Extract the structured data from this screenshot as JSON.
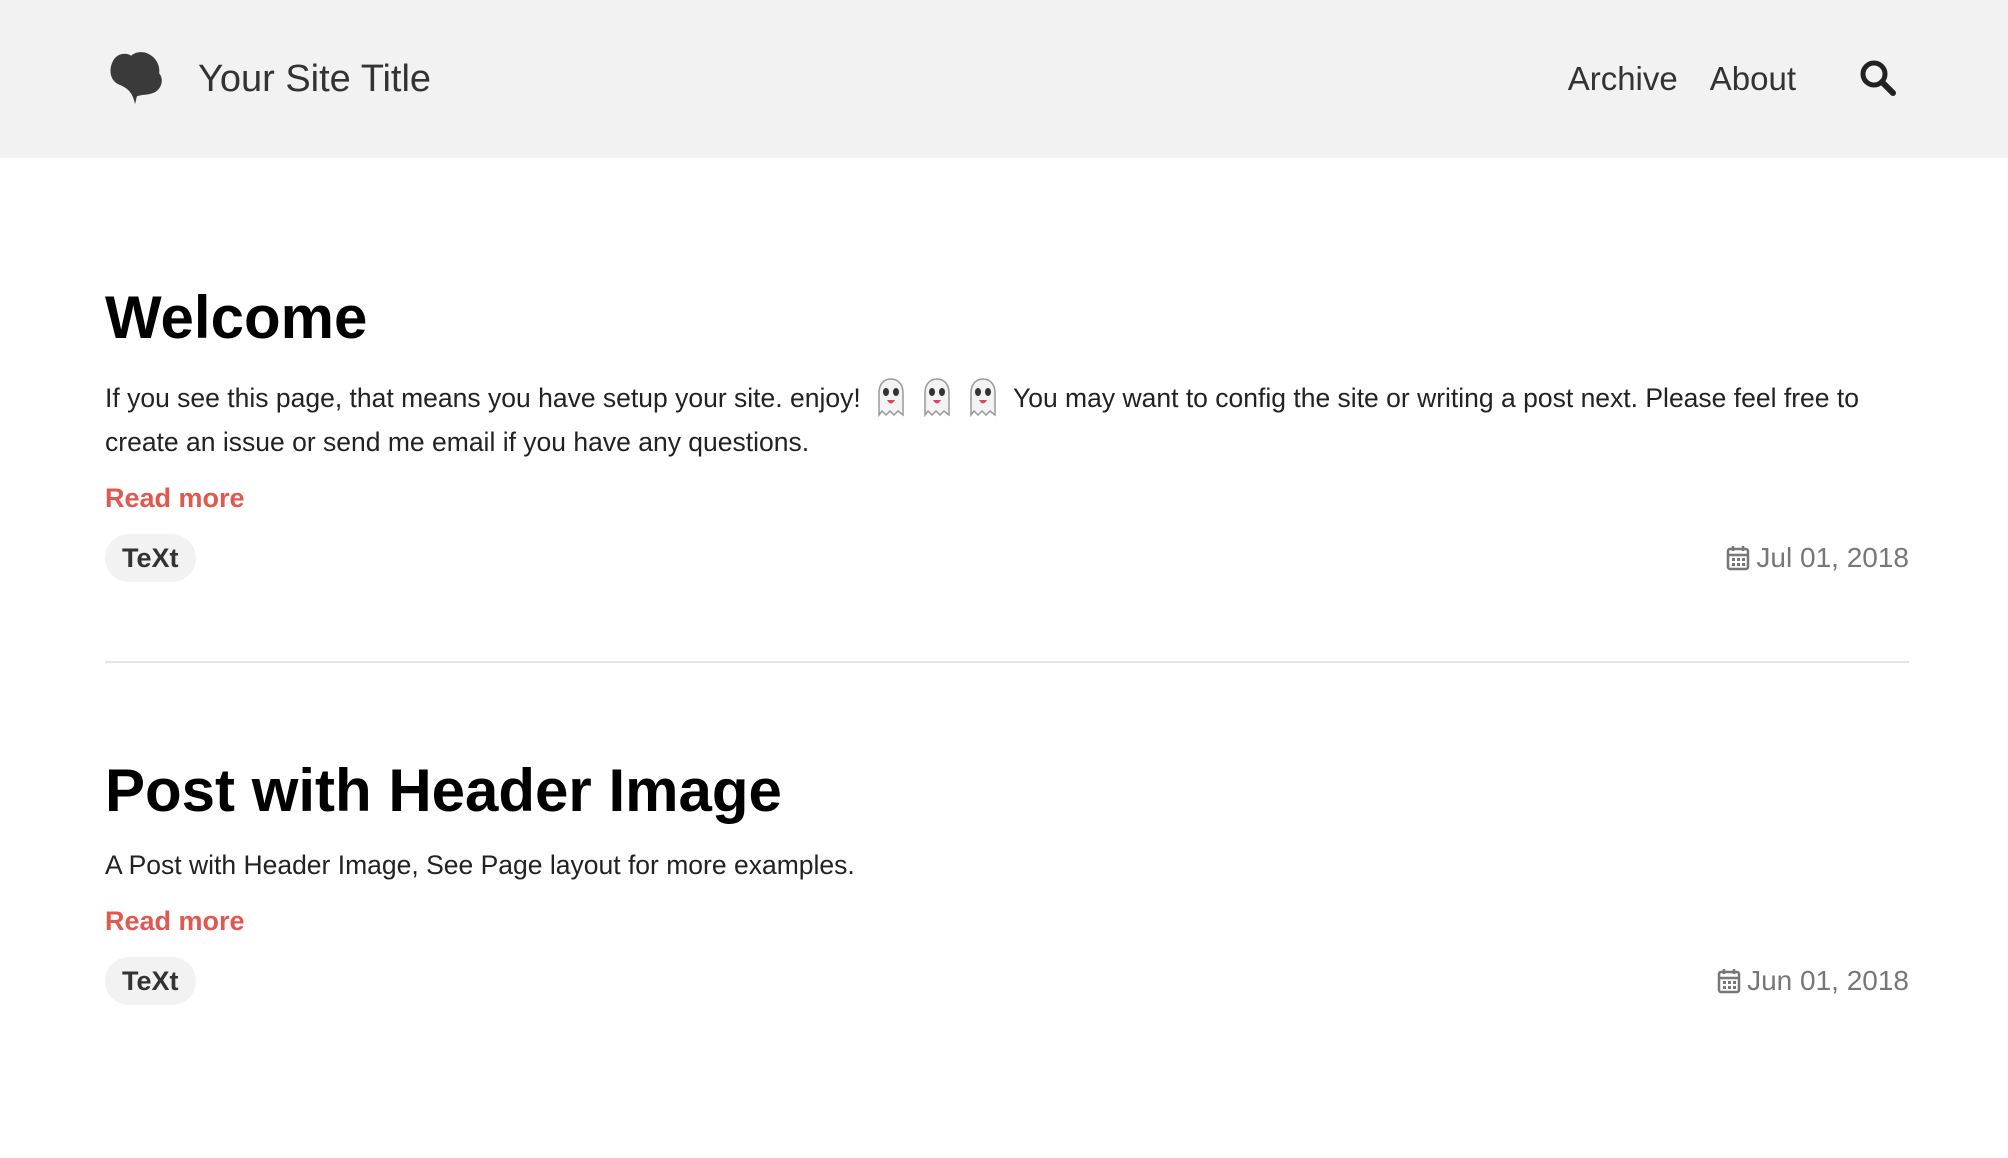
{
  "header": {
    "site_title": "Your Site Title",
    "logo_icon": "ginkgo-leaf-icon",
    "nav": [
      {
        "label": "Archive"
      },
      {
        "label": "About"
      }
    ],
    "search_icon": "search-icon"
  },
  "posts": [
    {
      "title": "Welcome",
      "excerpt_before": "If you see this page, that means you have setup your site. enjoy!",
      "excerpt_emoji": "👻 👻 👻",
      "excerpt_after": "You may want to config the site or writing a post next. Please feel free to create an issue or send me email if you have any questions.",
      "read_more": "Read more",
      "tag": "TeXt",
      "date": "Jul 01, 2018"
    },
    {
      "title": "Post with Header Image",
      "excerpt": "A Post with Header Image, See Page layout for more examples.",
      "read_more": "Read more",
      "tag": "TeXt",
      "date": "Jun 01, 2018"
    }
  ],
  "colors": {
    "header_bg": "#f2f2f2",
    "accent": "#e0584e",
    "meta_text": "#777777",
    "tag_bg": "#f2f2f2"
  }
}
